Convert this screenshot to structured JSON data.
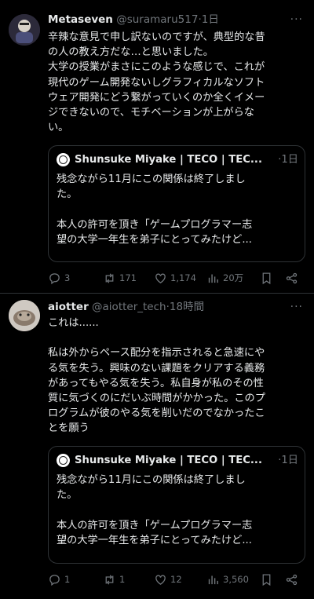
{
  "tweets": [
    {
      "author_name": "Metaseven",
      "handle": "@suramaru517",
      "time": "1日",
      "text": "辛辣な意見で申し訳ないのですが、典型的な昔\nの人の教え方だな…と思いました。\n大学の授業がまさにこのような感じで、これが\n現代のゲーム開発ないしグラフィカルなソフト\nウェア開発にどう繋がっていくのか全くイメー\nジできないので、モチベーションが上がらな\nい。",
      "quote": {
        "author": "Shunsuke Miyake | TECO | TEC...",
        "time": "1日",
        "text": "残念ながら11月にこの関係は終了しまし\nた。\n\n本人の許可を頂き「ゲームプログラマー志\n望の大学一年生を弟子にとってみたけど..."
      },
      "stats": {
        "replies": "3",
        "retweets": "171",
        "likes": "1,174",
        "views": "20万"
      }
    },
    {
      "author_name": "aiotter",
      "handle": "@aiotter_tech",
      "time": "18時間",
      "text": "これは......\n\n私は外からペース配分を指示されると急速にや\nる気を失う。興味のない課題をクリアする義務\nがあってもやる気を失う。私自身が私のその性\n質に気づくのにだいぶ時間がかかった。このプ\nログラムが彼のやる気を削いだのでなかったこ\nとを願う",
      "quote": {
        "author": "Shunsuke Miyake | TECO | TEC...",
        "time": "1日",
        "text": "残念ながら11月にこの関係は終了しまし\nた。\n\n本人の許可を頂き「ゲームプログラマー志\n望の大学一年生を弟子にとってみたけど..."
      },
      "stats": {
        "replies": "1",
        "retweets": "1",
        "likes": "12",
        "views": "3,560"
      }
    }
  ],
  "ui": {
    "separator": "·",
    "more": "···"
  },
  "colors": {
    "background": "#000000",
    "text": "#e7e9ea",
    "muted": "#71767b",
    "border": "#2f3336"
  }
}
